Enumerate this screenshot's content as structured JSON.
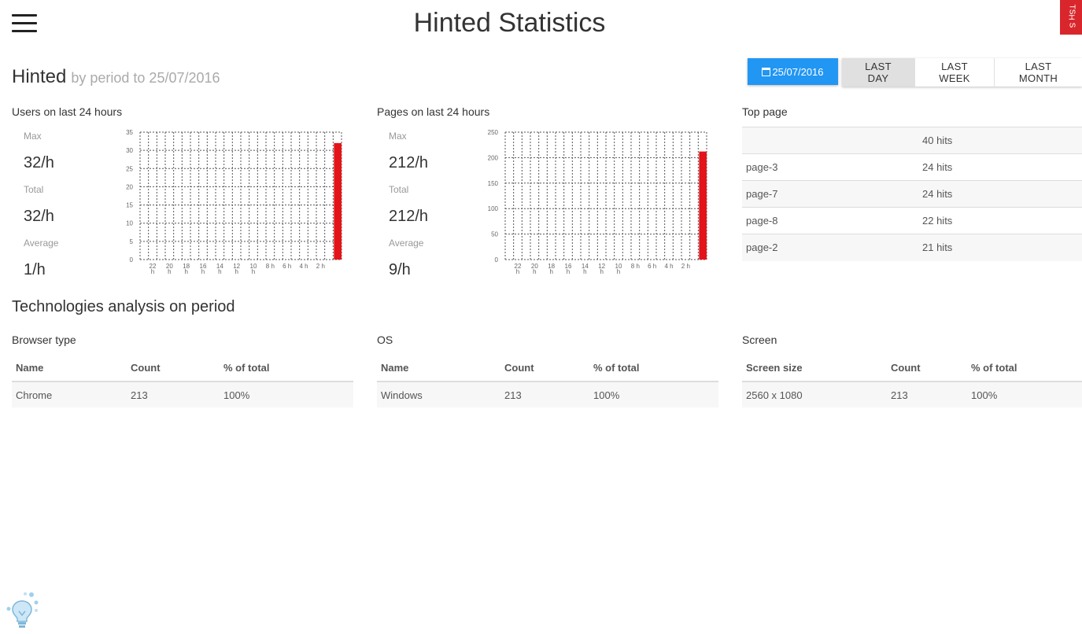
{
  "header": {
    "title": "Hinted Statistics",
    "logo_text": [
      "TS",
      "H",
      "S"
    ]
  },
  "page": {
    "title": "Hinted",
    "subtitle": "by period to 25/07/2016"
  },
  "toolbar": {
    "date_label": "25/07/2016",
    "periods": [
      "LAST DAY",
      "LAST WEEK",
      "LAST MONTH"
    ],
    "active_period": "LAST DAY",
    "date_button_color": "#2196f3"
  },
  "users_panel": {
    "title": "Users on last 24 hours",
    "max_label": "Max",
    "max_value": "32/h",
    "total_label": "Total",
    "total_value": "32/h",
    "avg_label": "Average",
    "avg_value": "1/h"
  },
  "pages_panel": {
    "title": "Pages on last 24 hours",
    "max_label": "Max",
    "max_value": "212/h",
    "total_label": "Total",
    "total_value": "212/h",
    "avg_label": "Average",
    "avg_value": "9/h"
  },
  "top_pages": {
    "title": "Top page",
    "rows": [
      {
        "name": "",
        "hits": "40 hits"
      },
      {
        "name": "page-3",
        "hits": "24 hits"
      },
      {
        "name": "page-7",
        "hits": "24 hits"
      },
      {
        "name": "page-8",
        "hits": "22 hits"
      },
      {
        "name": "page-2",
        "hits": "21 hits"
      }
    ]
  },
  "tech": {
    "title": "Technologies analysis on period",
    "browser": {
      "title": "Browser type",
      "headers": [
        "Name",
        "Count",
        "% of total"
      ],
      "rows": [
        [
          "Chrome",
          "213",
          "100%"
        ]
      ]
    },
    "os": {
      "title": "OS",
      "headers": [
        "Name",
        "Count",
        "% of total"
      ],
      "rows": [
        [
          "Windows",
          "213",
          "100%"
        ]
      ]
    },
    "screen": {
      "title": "Screen",
      "headers": [
        "Screen size",
        "Count",
        "% of total"
      ],
      "rows": [
        [
          "2560 x 1080",
          "213",
          "100%"
        ]
      ]
    }
  },
  "chart_data": [
    {
      "type": "bar",
      "x_tick_labels": [
        "22 h",
        "20 h",
        "18 h",
        "16 h",
        "14 h",
        "12 h",
        "10 h",
        "8 h",
        "6 h",
        "4 h",
        "2 h"
      ],
      "y_ticks": [
        0,
        5,
        10,
        15,
        20,
        25,
        30,
        35
      ],
      "ylim": [
        0,
        35
      ],
      "bar_count": 24,
      "values": [
        0,
        0,
        0,
        0,
        0,
        0,
        0,
        0,
        0,
        0,
        0,
        0,
        0,
        0,
        0,
        0,
        0,
        0,
        0,
        0,
        0,
        0,
        0,
        32
      ],
      "bar_color": "#e3151a",
      "grid": true
    },
    {
      "type": "bar",
      "x_tick_labels": [
        "22 h",
        "20 h",
        "18 h",
        "16 h",
        "14 h",
        "12 h",
        "10 h",
        "8 h",
        "6 h",
        "4 h",
        "2 h"
      ],
      "y_ticks": [
        0,
        50,
        100,
        150,
        200,
        250
      ],
      "ylim": [
        0,
        250
      ],
      "bar_count": 24,
      "values": [
        0,
        0,
        0,
        0,
        0,
        0,
        0,
        0,
        0,
        0,
        0,
        0,
        0,
        0,
        0,
        0,
        0,
        0,
        0,
        0,
        0,
        0,
        0,
        212
      ],
      "bar_color": "#e3151a",
      "grid": true
    }
  ]
}
